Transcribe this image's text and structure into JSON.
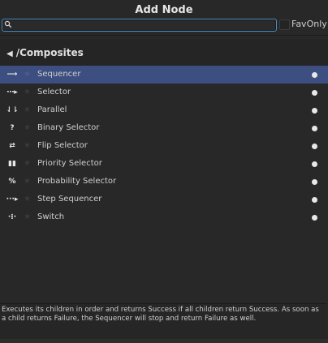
{
  "window": {
    "title": "Add Node"
  },
  "search": {
    "value": "",
    "placeholder": ""
  },
  "fav_only": {
    "label": "FavOnly",
    "checked": false
  },
  "breadcrumb": {
    "path": "/Composites"
  },
  "nodes": [
    {
      "label": "Sequencer",
      "icon": "sequencer-arrow-icon",
      "glyph": "⟶",
      "selected": true
    },
    {
      "label": "Selector",
      "icon": "selector-icon",
      "glyph": "⋯▸",
      "selected": false
    },
    {
      "label": "Parallel",
      "icon": "parallel-icon",
      "glyph": "⇃⇂",
      "selected": false
    },
    {
      "label": "Binary Selector",
      "icon": "binary-selector-icon",
      "glyph": "?",
      "selected": false
    },
    {
      "label": "Flip Selector",
      "icon": "flip-selector-icon",
      "glyph": "⇄",
      "selected": false
    },
    {
      "label": "Priority Selector",
      "icon": "priority-selector-icon",
      "glyph": "▮▮",
      "selected": false
    },
    {
      "label": "Probability Selector",
      "icon": "probability-selector-icon",
      "glyph": "%",
      "selected": false
    },
    {
      "label": "Step Sequencer",
      "icon": "step-sequencer-icon",
      "glyph": "···▸",
      "selected": false
    },
    {
      "label": "Switch",
      "icon": "switch-icon",
      "glyph": "·⁝·",
      "selected": false
    }
  ],
  "description": "Executes its children in order and returns Success if all children return Success. As soon as a child returns Failure, the Sequencer will stop and return Failure as well.",
  "colors": {
    "selection": "#3d4e80",
    "search_border": "#4a8fc4",
    "background": "#282828"
  }
}
